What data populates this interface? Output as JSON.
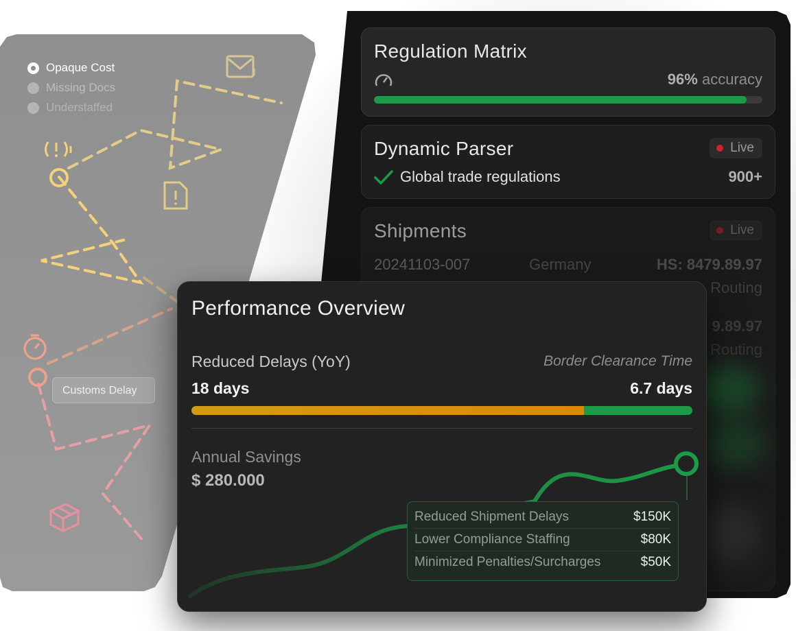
{
  "problems": {
    "options": [
      {
        "label": "Opaque Cost",
        "selected": true
      },
      {
        "label": "Missing Docs",
        "selected": false
      },
      {
        "label": "Understaffed",
        "selected": false
      }
    ],
    "chip_label": "Customs Delay"
  },
  "regulation_matrix": {
    "title": "Regulation Matrix",
    "accuracy_value": "96%",
    "accuracy_suffix": "accuracy",
    "progress": 0.96
  },
  "dynamic_parser": {
    "title": "Dynamic Parser",
    "status": "Live",
    "item_label": "Global trade regulations",
    "item_count": "900+"
  },
  "shipments": {
    "title": "Shipments",
    "status": "Live",
    "rows": [
      {
        "id": "20241103-007",
        "country": "Germany",
        "hs": "HS: 8479.89.97"
      }
    ],
    "fragments": [
      "Routing",
      "9.89.97",
      "Routing"
    ]
  },
  "performance": {
    "title": "Performance Overview",
    "reduced_delays_label": "Reduced Delays (YoY)",
    "reduced_delays_value": "18 days",
    "clearance_label": "Border Clearance Time",
    "clearance_value": "6.7 days",
    "clearance_share": 0.784,
    "savings_label": "Annual Savings",
    "savings_value": "$ 280.000",
    "breakdown": [
      {
        "label": "Reduced Shipment Delays",
        "value": "$150K"
      },
      {
        "label": "Lower Compliance Staffing",
        "value": "$80K"
      },
      {
        "label": "Minimized Penalties/Surcharges",
        "value": "$50K"
      }
    ]
  },
  "colors": {
    "accent_green": "#1d9a47",
    "accent_orange": "#d8900a",
    "live_dot": "#d1212b"
  }
}
